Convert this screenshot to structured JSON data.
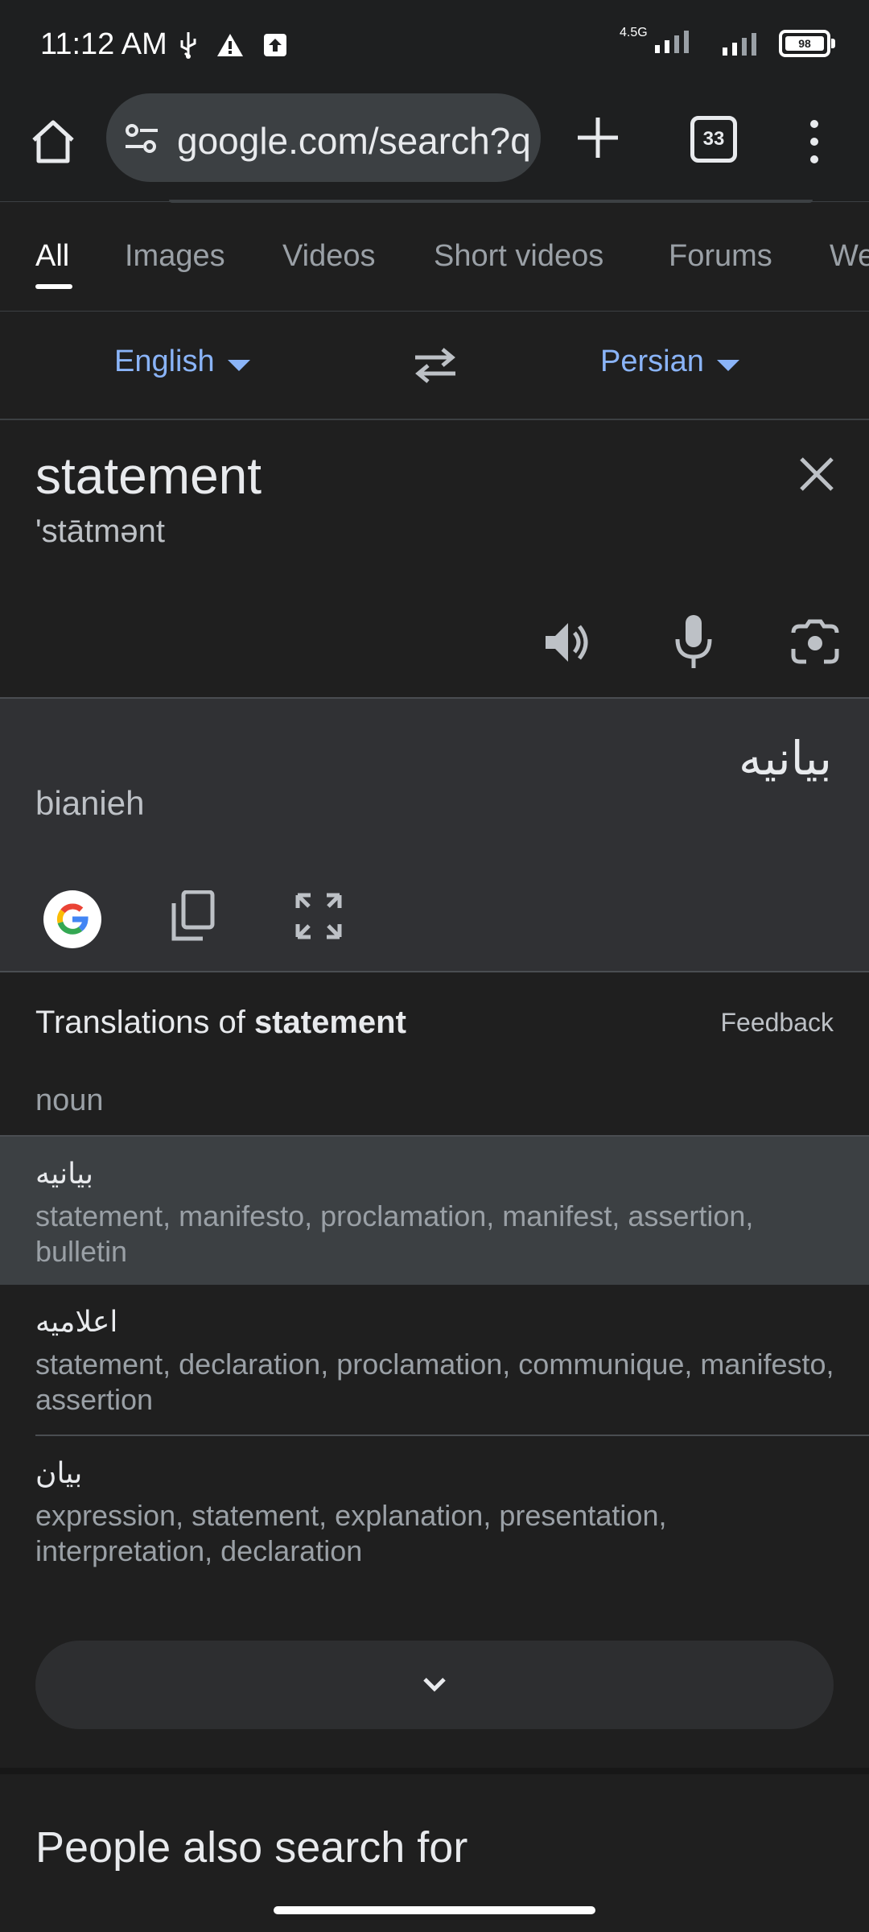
{
  "status_bar": {
    "time": "11:12 AM",
    "network": "4.5G",
    "battery": "98"
  },
  "browser": {
    "url": "google.com/search?q",
    "tab_count": "33"
  },
  "search_tabs": [
    "All",
    "Images",
    "Videos",
    "Short videos",
    "Forums",
    "We"
  ],
  "translator": {
    "source_lang": "English",
    "target_lang": "Persian",
    "source_text": "statement",
    "source_phonetic": "'stātmənt",
    "target_text": "بیانیه",
    "target_romanization": "bianieh"
  },
  "translations": {
    "title_prefix": "Translations of",
    "title_word": "statement",
    "feedback": "Feedback",
    "part_of_speech": "noun",
    "rows": [
      {
        "word": "بیانیه",
        "meanings": "statement, manifesto, proclamation, manifest, assertion, bulletin"
      },
      {
        "word": "اعلامیه",
        "meanings": "statement, declaration, proclamation, communique, manifesto, assertion"
      },
      {
        "word": "بیان",
        "meanings": "expression, statement, explanation, presentation, interpretation, declaration"
      }
    ]
  },
  "people_also_search": "People also search for"
}
